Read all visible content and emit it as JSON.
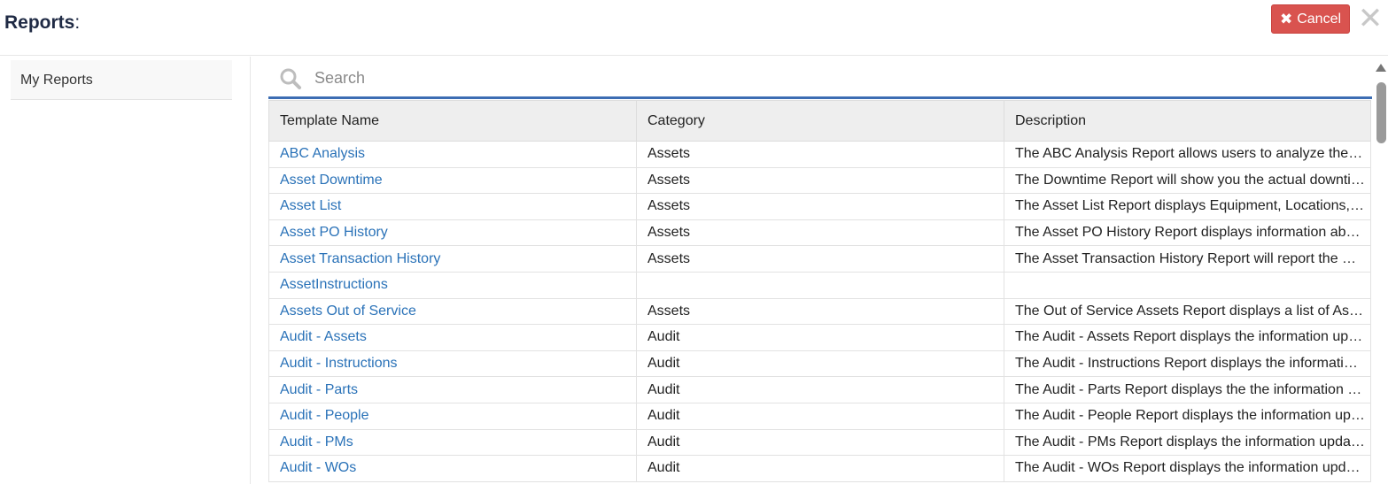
{
  "header": {
    "title": "Reports",
    "title_suffix": ":",
    "cancel_label": "Cancel",
    "close_glyph": "✕"
  },
  "sidebar": {
    "items": [
      {
        "label": "My Reports"
      }
    ]
  },
  "search": {
    "placeholder": "Search",
    "value": ""
  },
  "table": {
    "columns": [
      "Template Name",
      "Category",
      "Description"
    ],
    "rows": [
      {
        "name": "ABC Analysis",
        "category": "Assets",
        "description": "The ABC Analysis Report allows users to analyze the…"
      },
      {
        "name": "Asset Downtime",
        "category": "Assets",
        "description": "The Downtime Report will show you the actual downti…"
      },
      {
        "name": "Asset List",
        "category": "Assets",
        "description": "The Asset List Report displays Equipment, Locations,…"
      },
      {
        "name": "Asset PO History",
        "category": "Assets",
        "description": "The Asset PO History Report displays information ab…"
      },
      {
        "name": "Asset Transaction History",
        "category": "Assets",
        "description": "The Asset Transaction History Report will report the …"
      },
      {
        "name": "AssetInstructions",
        "category": "",
        "description": ""
      },
      {
        "name": "Assets Out of Service",
        "category": "Assets",
        "description": "The Out of Service Assets Report displays a list of As…"
      },
      {
        "name": "Audit - Assets",
        "category": "Audit",
        "description": "The Audit - Assets Report displays the information up…"
      },
      {
        "name": "Audit - Instructions",
        "category": "Audit",
        "description": "The Audit - Instructions Report displays the informati…"
      },
      {
        "name": "Audit - Parts",
        "category": "Audit",
        "description": "The Audit - Parts Report displays the the information …"
      },
      {
        "name": "Audit - People",
        "category": "Audit",
        "description": "The Audit - People Report displays the information up…"
      },
      {
        "name": "Audit - PMs",
        "category": "Audit",
        "description": "The Audit - PMs Report displays the information upda…"
      },
      {
        "name": "Audit - WOs",
        "category": "Audit",
        "description": "The Audit - WOs Report displays the information upd…"
      }
    ]
  },
  "colors": {
    "accent": "#3c6db3",
    "link": "#2a72b8",
    "cancel": "#d9534f",
    "header_bg": "#eeeeee"
  },
  "icons": {
    "search": "search-icon",
    "cancel": "close-icon",
    "close": "close-icon"
  }
}
